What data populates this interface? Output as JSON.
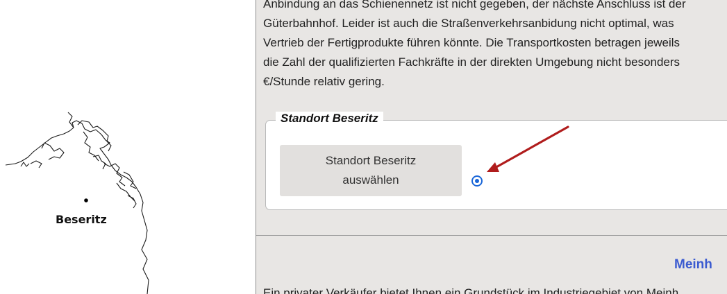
{
  "map": {
    "city_label": "Beseritz"
  },
  "content": {
    "paragraph_lines": [
      "Anbindung an das Schienennetz ist nicht gegeben, der nächste Anschluss ist der",
      "Güterbahnhof. Leider ist auch die Straßenverkehrsanbidung nicht optimal, was",
      "Vertrieb der Fertigprodukte führen könnte. Die Transportkosten betragen jeweils",
      "die Zahl der qualifizierten Fachkräfte in der direkten Umgebung nicht besonders",
      "€/Stunde relativ gering."
    ],
    "fieldset": {
      "legend": "Standort Beseritz",
      "button_label": "Standort Beseritz auswählen",
      "radio_checked": true
    },
    "next_section_title": "Meinh",
    "next_section_text": "Ein privater Verkäufer bietet Ihnen ein Grundstück im Industriegebiet von Meinh"
  },
  "colors": {
    "accent": "#1a66d8",
    "arrow": "#b01c1c",
    "section_title": "#3b5bd0",
    "panel_bg": "#e8e6e4"
  }
}
